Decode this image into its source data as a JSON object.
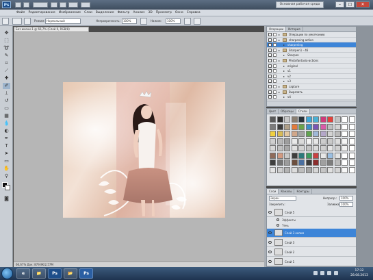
{
  "app": {
    "logo": "Ps",
    "workspace_button": "Основная рабочая среда",
    "window_controls": [
      "–",
      "□",
      "✕"
    ]
  },
  "menu": [
    "Файл",
    "Редактирование",
    "Изображение",
    "Слои",
    "Выделение",
    "Фильтр",
    "Анализ",
    "3D",
    "Просмотр",
    "Окно",
    "Справка"
  ],
  "options": {
    "mode_label": "Режим:",
    "mode_value": "Нормальный",
    "opacity_label": "Непрозрачность:",
    "opacity_value": "100%",
    "flow_label": "Нажим:",
    "flow_value": "100%"
  },
  "document_tab": "Без имени-1 @ 66,7% (Слой 0, RGB/8)",
  "status_bar": "66,67%    Док: 879,9K/2,57M",
  "actions_panel": {
    "tabs": [
      "Операции",
      "История"
    ],
    "rows": [
      {
        "name": "Операции по умолчанию",
        "type": "set"
      },
      {
        "name": "sharpening action",
        "type": "set"
      },
      {
        "name": "sharpening",
        "type": "action",
        "selected": true
      },
      {
        "name": "Sharpen1 - 46",
        "type": "set"
      },
      {
        "name": "Sharpen",
        "type": "action"
      },
      {
        "name": "Photofantasia-actions",
        "type": "set"
      },
      {
        "name": "original",
        "type": "action"
      },
      {
        "name": "v1",
        "type": "action"
      },
      {
        "name": "v2",
        "type": "action"
      },
      {
        "name": "v3",
        "type": "action"
      },
      {
        "name": "capture",
        "type": "set"
      },
      {
        "name": "Вырезать",
        "type": "set"
      },
      {
        "name": "v4",
        "type": "action"
      }
    ]
  },
  "swatches_panel": {
    "tabs": [
      "Цвет",
      "Образцы",
      "Стили"
    ],
    "colors": [
      "#5a5a5a",
      "#2f2f2f",
      "#c7c7c7",
      "#8a7f72",
      "#27323a",
      "#3fa7d6",
      "#4ab0d4",
      "#cf3a7a",
      "#e2423b",
      "#c2c2c2",
      "#ffffff",
      "#ffffff",
      "#7c7c7c",
      "#3c3c3c",
      "#b0a089",
      "#e47a3a",
      "#6aa34a",
      "#3b8fc9",
      "#7a55b5",
      "#d95aa8",
      "#bfbfbf",
      "#d4d4d4",
      "#ffffff",
      "#ffffff",
      "#f0d040",
      "#d8bb57",
      "#e3c8a0",
      "#d1a78a",
      "#a4a4a4",
      "#60a44f",
      "#9fb8d8",
      "#b4a7c9",
      "#d3d3d3",
      "#bbbbbb",
      "#ffffff",
      "#ffffff",
      "#cfcfcf",
      "#b8b8b8",
      "#9e9e9e",
      "#e9e9e9",
      "#dadada",
      "#f2f2f2",
      "#e7e7e7",
      "#cccccc",
      "#c9c9c9",
      "#dcdcdc",
      "#f5f5f5",
      "#ffffff",
      "#d7d7d7",
      "#c0c0c0",
      "#a8a8a8",
      "#e0e0e0",
      "#d2d2d2",
      "#c4c4c4",
      "#d9d9d9",
      "#cfcfcf",
      "#e5e5e5",
      "#d0d0d0",
      "#f0f0f0",
      "#ffffff",
      "#8f6b5a",
      "#d29a82",
      "#c9c9c9",
      "#3d3d3d",
      "#2c7a7b",
      "#3c9c5c",
      "#c94141",
      "#e7e7e7",
      "#9bbfe2",
      "#e4e4e4",
      "#ffffff",
      "#ffffff",
      "#3f3f3f",
      "#747474",
      "#9c9c9c",
      "#6b4e3e",
      "#4a6fa0",
      "#3b3b3b",
      "#8c2d2d",
      "#a0a0a0",
      "#7d7d7d",
      "#bcbcbc",
      "#ffffff",
      "#ffffff",
      "#e4e4e4",
      "#cfcfcf",
      "#b3b3b3",
      "#dcdcdc",
      "#bdbdbd",
      "#a5a5a5",
      "#d6d6d6",
      "#c5c5c5",
      "#e0e0e0",
      "#d4d4d4",
      "#f7f7f7",
      "#ffffff"
    ]
  },
  "layers_panel": {
    "tabs": [
      "Слои",
      "Каналы",
      "Контуры"
    ],
    "blend_mode": "Экран",
    "opacity_label": "Непрозр.:",
    "opacity_value": "100%",
    "lock_label": "Закрепить:",
    "fill_label": "Заливка:",
    "fill_value": "100%",
    "layers": [
      {
        "name": "Слой 5",
        "kind": "layer",
        "selected": false
      },
      {
        "name": "Эффекты",
        "kind": "fx"
      },
      {
        "name": "Тень",
        "kind": "fx"
      },
      {
        "name": "Слой 3 копия",
        "kind": "layer",
        "selected": true
      },
      {
        "name": "Слой 3",
        "kind": "layer",
        "selected": false
      },
      {
        "name": "Слой 2",
        "kind": "layer",
        "selected": false
      },
      {
        "name": "Слой 1",
        "kind": "layer",
        "selected": false
      }
    ]
  },
  "taskbar": {
    "apps": [
      "e",
      "📁",
      "Ps",
      "📂",
      "Ps"
    ],
    "clock_time": "17:32",
    "clock_date": "28.08.2013"
  }
}
